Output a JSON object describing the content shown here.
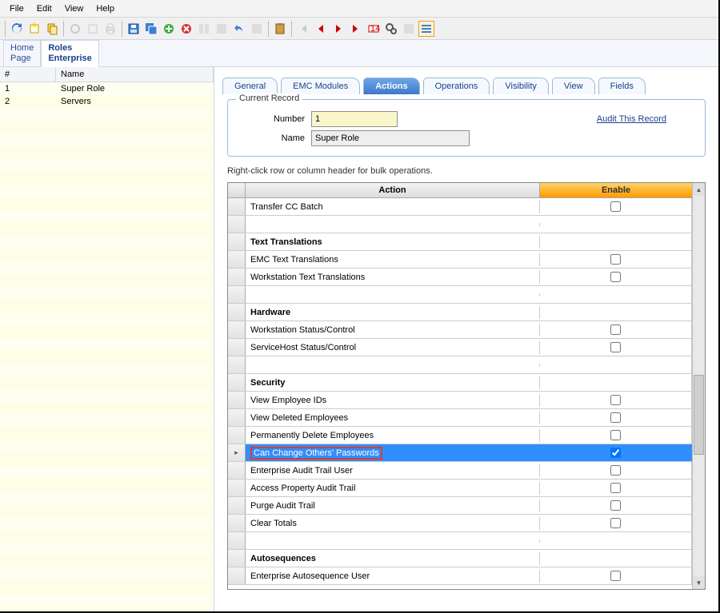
{
  "menu": {
    "file": "File",
    "edit": "Edit",
    "view": "View",
    "help": "Help"
  },
  "navTabs": {
    "home1": "Home",
    "home2": "Page",
    "roles1": "Roles",
    "roles2": "Enterprise"
  },
  "leftGrid": {
    "headers": {
      "num": "#",
      "name": "Name"
    },
    "rows": [
      {
        "num": "1",
        "name": "Super Role"
      },
      {
        "num": "2",
        "name": "Servers"
      }
    ]
  },
  "rightTabs": {
    "general": "General",
    "emc": "EMC Modules",
    "actions": "Actions",
    "operations": "Operations",
    "visibility": "Visibility",
    "view": "View",
    "fields": "Fields"
  },
  "record": {
    "legend": "Current Record",
    "numberLabel": "Number",
    "numberValue": "1",
    "nameLabel": "Name",
    "nameValue": "Super Role",
    "auditLink": "Audit This Record"
  },
  "hint": "Right-click row or column header for bulk operations.",
  "grid": {
    "headers": {
      "action": "Action",
      "enable": "Enable"
    },
    "rows": [
      {
        "type": "item",
        "label": "Transfer CC Batch",
        "checked": false
      },
      {
        "type": "spacer"
      },
      {
        "type": "section",
        "label": "Text Translations"
      },
      {
        "type": "item",
        "label": "EMC Text Translations",
        "checked": false
      },
      {
        "type": "item",
        "label": "Workstation Text Translations",
        "checked": false
      },
      {
        "type": "spacer"
      },
      {
        "type": "section",
        "label": "Hardware"
      },
      {
        "type": "item",
        "label": "Workstation Status/Control",
        "checked": false
      },
      {
        "type": "item",
        "label": "ServiceHost Status/Control",
        "checked": false
      },
      {
        "type": "spacer"
      },
      {
        "type": "section",
        "label": "Security"
      },
      {
        "type": "item",
        "label": "View Employee IDs",
        "checked": false
      },
      {
        "type": "item",
        "label": "View Deleted Employees",
        "checked": false
      },
      {
        "type": "item",
        "label": "Permanently Delete Employees",
        "checked": false
      },
      {
        "type": "item",
        "label": "Can Change Others' Passwords",
        "checked": true,
        "selected": true,
        "highlight": true
      },
      {
        "type": "item",
        "label": "Enterprise Audit Trail User",
        "checked": false
      },
      {
        "type": "item",
        "label": "Access Property Audit Trail",
        "checked": false
      },
      {
        "type": "item",
        "label": "Purge Audit Trail",
        "checked": false
      },
      {
        "type": "item",
        "label": "Clear Totals",
        "checked": false
      },
      {
        "type": "spacer"
      },
      {
        "type": "section",
        "label": "Autosequences"
      },
      {
        "type": "item",
        "label": "Enterprise Autosequence User",
        "checked": false
      }
    ]
  }
}
